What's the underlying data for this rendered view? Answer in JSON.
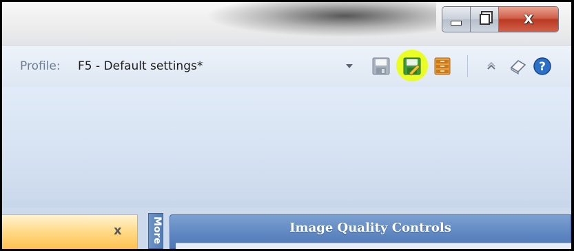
{
  "window": {
    "minimize_icon": "minimize-icon",
    "maximize_icon": "restore-icon",
    "close_label": "X"
  },
  "toolbar": {
    "profile_label": "Profile:",
    "profile_value": "F5 - Default settings*",
    "icons": [
      "save-icon",
      "save-as-icon",
      "profiles-icon",
      "collapse-icon",
      "eraser-icon",
      "help-icon"
    ],
    "highlight_color": "#eaff00"
  },
  "panels": {
    "left_close_label": "x",
    "vertical_tab_label": "More",
    "image_quality_title": "Image Quality Controls"
  }
}
